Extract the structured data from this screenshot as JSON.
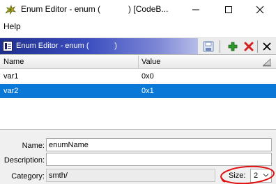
{
  "window": {
    "title": "Enum Editor - enum (            ) [CodeB...",
    "minimize_glyph": "—",
    "maximize_glyph": "☐",
    "close_glyph": "✕"
  },
  "menu": {
    "items": [
      {
        "label": "Help"
      }
    ]
  },
  "panel": {
    "title": "Enum Editor - enum (            )",
    "toolbar": [
      "save-icon",
      "add-icon",
      "delete-icon",
      "close-icon"
    ]
  },
  "table": {
    "columns": [
      "Name",
      "Value"
    ],
    "rows": [
      {
        "name": "var1",
        "value": "0x0"
      },
      {
        "name": "var2",
        "value": "0x1"
      }
    ],
    "selected_row": 1
  },
  "form": {
    "name_label": "Name:",
    "name_value": "enumName",
    "description_label": "Description:",
    "description_value": "",
    "category_label": "Category:",
    "category_value": "smth/",
    "size_label": "Size:",
    "size_value": "2"
  },
  "colors": {
    "selection": "#0a78d7",
    "panel_title_start": "#1f2f8f",
    "annotation_circle": "#e01010"
  }
}
